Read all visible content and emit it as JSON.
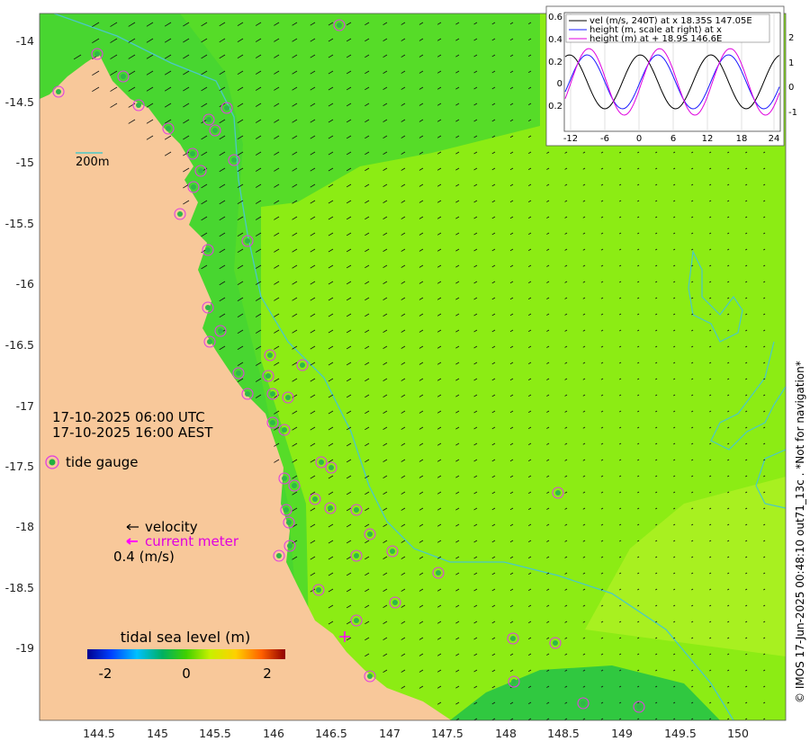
{
  "map": {
    "lat_ticks": [
      "-14",
      "-14.5",
      "-15",
      "-15.5",
      "-16",
      "-16.5",
      "-17",
      "-17.5",
      "-18",
      "-18.5",
      "-19"
    ],
    "lon_ticks": [
      "144.5",
      "145",
      "145.5",
      "146",
      "146.5",
      "147",
      "147.5",
      "148",
      "148.5",
      "149",
      "149.5",
      "150"
    ],
    "timestamp_utc": "17-10-2025 06:00 UTC",
    "timestamp_aest": "17-10-2025 16:00 AEST",
    "isobath_label": "200m",
    "colors": {
      "land": "#f8c89a",
      "coast_line": "#4ac8c8",
      "gauge_ring": "#e040e0",
      "current_meter": "#ff00ff"
    }
  },
  "legend": {
    "tide_gauge": "tide gauge",
    "velocity": "velocity",
    "current_meter": "current meter",
    "scale": "0.4 (m/s)",
    "colorbar_title": "tidal sea level (m)",
    "colorbar_ticks": [
      "-2",
      "0",
      "2"
    ]
  },
  "inset": {
    "y_left_ticks": [
      "0.6",
      "0.4",
      "0.2",
      "0",
      "0.2"
    ],
    "y_right_ticks": [
      "2",
      "1",
      "0",
      "-1"
    ],
    "x_ticks": [
      "-12",
      "-6",
      "0",
      "6",
      "12",
      "18",
      "24"
    ],
    "legend": [
      {
        "text": "vel (m/s, 240T) at x 18.35S 147.05E",
        "color": "#000000"
      },
      {
        "text": "height (m, scale at right) at x",
        "color": "#1a1aff"
      },
      {
        "text": "height (m) at + 18.9S 146.6E",
        "color": "#e000e0"
      }
    ]
  },
  "credit": "© IMOS 17-Jun-2025 00:48:10 out71_13c . *Not for navigation*"
}
